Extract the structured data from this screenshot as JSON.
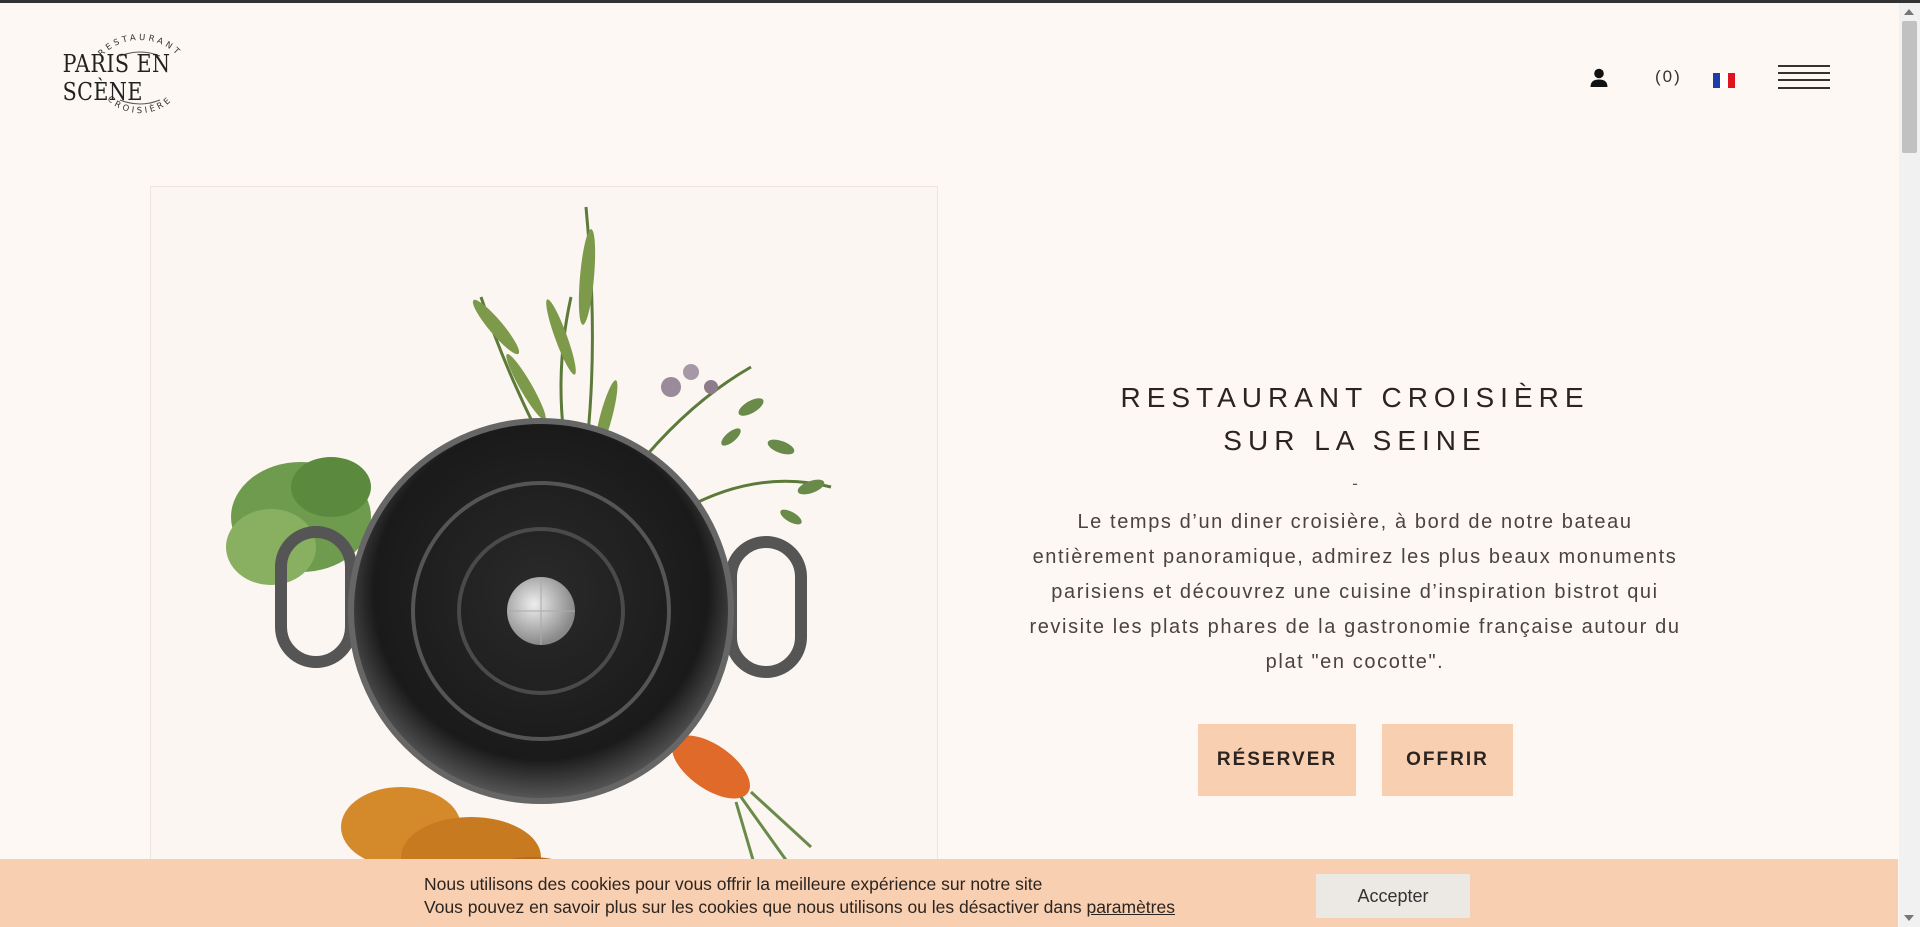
{
  "header": {
    "logo": {
      "top_text": "RESTAURANT",
      "name": "PARIS EN SCÈNE",
      "bottom_text": "CROISIÈRE"
    },
    "account_icon": "user-icon",
    "cart_count": "(0)",
    "language_flag": "fr-flag",
    "menu_icon": "hamburger-menu-icon"
  },
  "hero": {
    "image_alt": "cast-iron-cocotte-with-vegetables-illustration",
    "title_line1": "RESTAURANT CROISIÈRE",
    "title_line2": "SUR LA SEINE",
    "separator": "-",
    "description": "Le temps d’un diner croisière, à bord de notre bateau entièrement panoramique, admirez les plus beaux monuments parisiens et découvrez une cuisine d’inspiration bistrot qui revisite les plats phares de la gastronomie française autour du plat \"en cocotte\".",
    "reserve_label": "RÉSERVER",
    "offer_label": "OFFRIR"
  },
  "cookie_banner": {
    "line1": "Nous utilisons des cookies pour vous offrir la meilleure expérience sur notre site",
    "line2_prefix": "Vous pouvez en savoir plus sur les cookies que nous utilisons ou les désactiver dans ",
    "link_label": "paramètres",
    "accept_label": "Accepter"
  },
  "colors": {
    "background": "#fdf8f3",
    "accent": "#f8cfb0",
    "text": "#2b2420"
  }
}
